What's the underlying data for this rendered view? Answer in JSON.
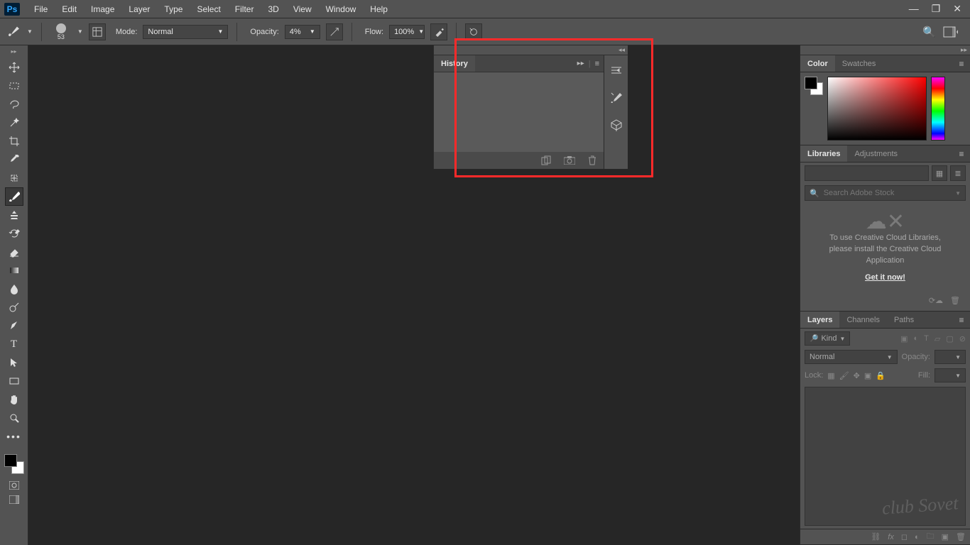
{
  "menu": {
    "items": [
      "File",
      "Edit",
      "Image",
      "Layer",
      "Type",
      "Select",
      "Filter",
      "3D",
      "View",
      "Window",
      "Help"
    ]
  },
  "window_controls": {
    "min": "—",
    "max": "❐",
    "close": "✕"
  },
  "options": {
    "brush_size": "53",
    "mode_label": "Mode:",
    "mode_value": "Normal",
    "opacity_label": "Opacity:",
    "opacity_value": "4%",
    "flow_label": "Flow:",
    "flow_value": "100%"
  },
  "tools": [
    {
      "name": "move-tool",
      "glyph": "✥"
    },
    {
      "name": "marquee-tool",
      "glyph": "▭"
    },
    {
      "name": "lasso-tool",
      "glyph": "⟋"
    },
    {
      "name": "magic-wand-tool",
      "glyph": "✧"
    },
    {
      "name": "crop-tool",
      "glyph": "⟡"
    },
    {
      "name": "eyedropper-tool",
      "glyph": "✎"
    },
    {
      "name": "spot-heal-tool",
      "glyph": "◌"
    },
    {
      "name": "brush-tool",
      "glyph": "🖌"
    },
    {
      "name": "clone-stamp-tool",
      "glyph": "▲"
    },
    {
      "name": "history-brush-tool",
      "glyph": "↺"
    },
    {
      "name": "eraser-tool",
      "glyph": "◧"
    },
    {
      "name": "gradient-tool",
      "glyph": "▤"
    },
    {
      "name": "blur-tool",
      "glyph": "∿"
    },
    {
      "name": "dodge-tool",
      "glyph": "❍"
    },
    {
      "name": "pen-tool",
      "glyph": "✒"
    },
    {
      "name": "type-tool",
      "glyph": "T"
    },
    {
      "name": "path-select-tool",
      "glyph": "↖"
    },
    {
      "name": "rectangle-tool",
      "glyph": "▭"
    },
    {
      "name": "hand-tool",
      "glyph": "✋"
    },
    {
      "name": "zoom-tool",
      "glyph": "🔍"
    }
  ],
  "history": {
    "tab": "History",
    "footer_icons": [
      "new-document-icon",
      "camera-icon",
      "trash-icon"
    ]
  },
  "dock_icons": [
    "paragraph-panel-icon",
    "brush-presets-panel-icon",
    "3d-panel-icon"
  ],
  "color_panel": {
    "tabs": [
      "Color",
      "Swatches"
    ]
  },
  "libraries_panel": {
    "tabs": [
      "Libraries",
      "Adjustments"
    ],
    "search_placeholder": "Search Adobe Stock",
    "msg_line1": "To use Creative Cloud Libraries,",
    "msg_line2": "please install the Creative Cloud",
    "msg_line3": "Application",
    "cta": "Get it now!"
  },
  "layers_panel": {
    "tabs": [
      "Layers",
      "Channels",
      "Paths"
    ],
    "kind_label": "Kind",
    "blend_value": "Normal",
    "opacity_label": "Opacity:",
    "lock_label": "Lock:",
    "fill_label": "Fill:"
  },
  "watermark": "club Sovet"
}
